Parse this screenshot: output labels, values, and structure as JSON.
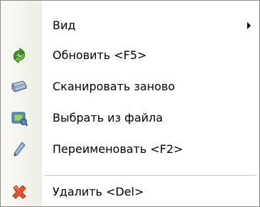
{
  "menu": {
    "items": [
      {
        "label": "Вид",
        "icon": "",
        "has_submenu": true
      },
      {
        "label": "Обновить <F5>",
        "icon": "refresh-icon"
      },
      {
        "label": "Сканировать заново",
        "icon": "scanner-icon"
      },
      {
        "label": "Выбрать из файла",
        "icon": "open-file-icon"
      },
      {
        "label": "Переименовать <F2>",
        "icon": "pencil-icon"
      },
      {
        "label": "Удалить <Del>",
        "icon": "delete-icon"
      }
    ]
  }
}
